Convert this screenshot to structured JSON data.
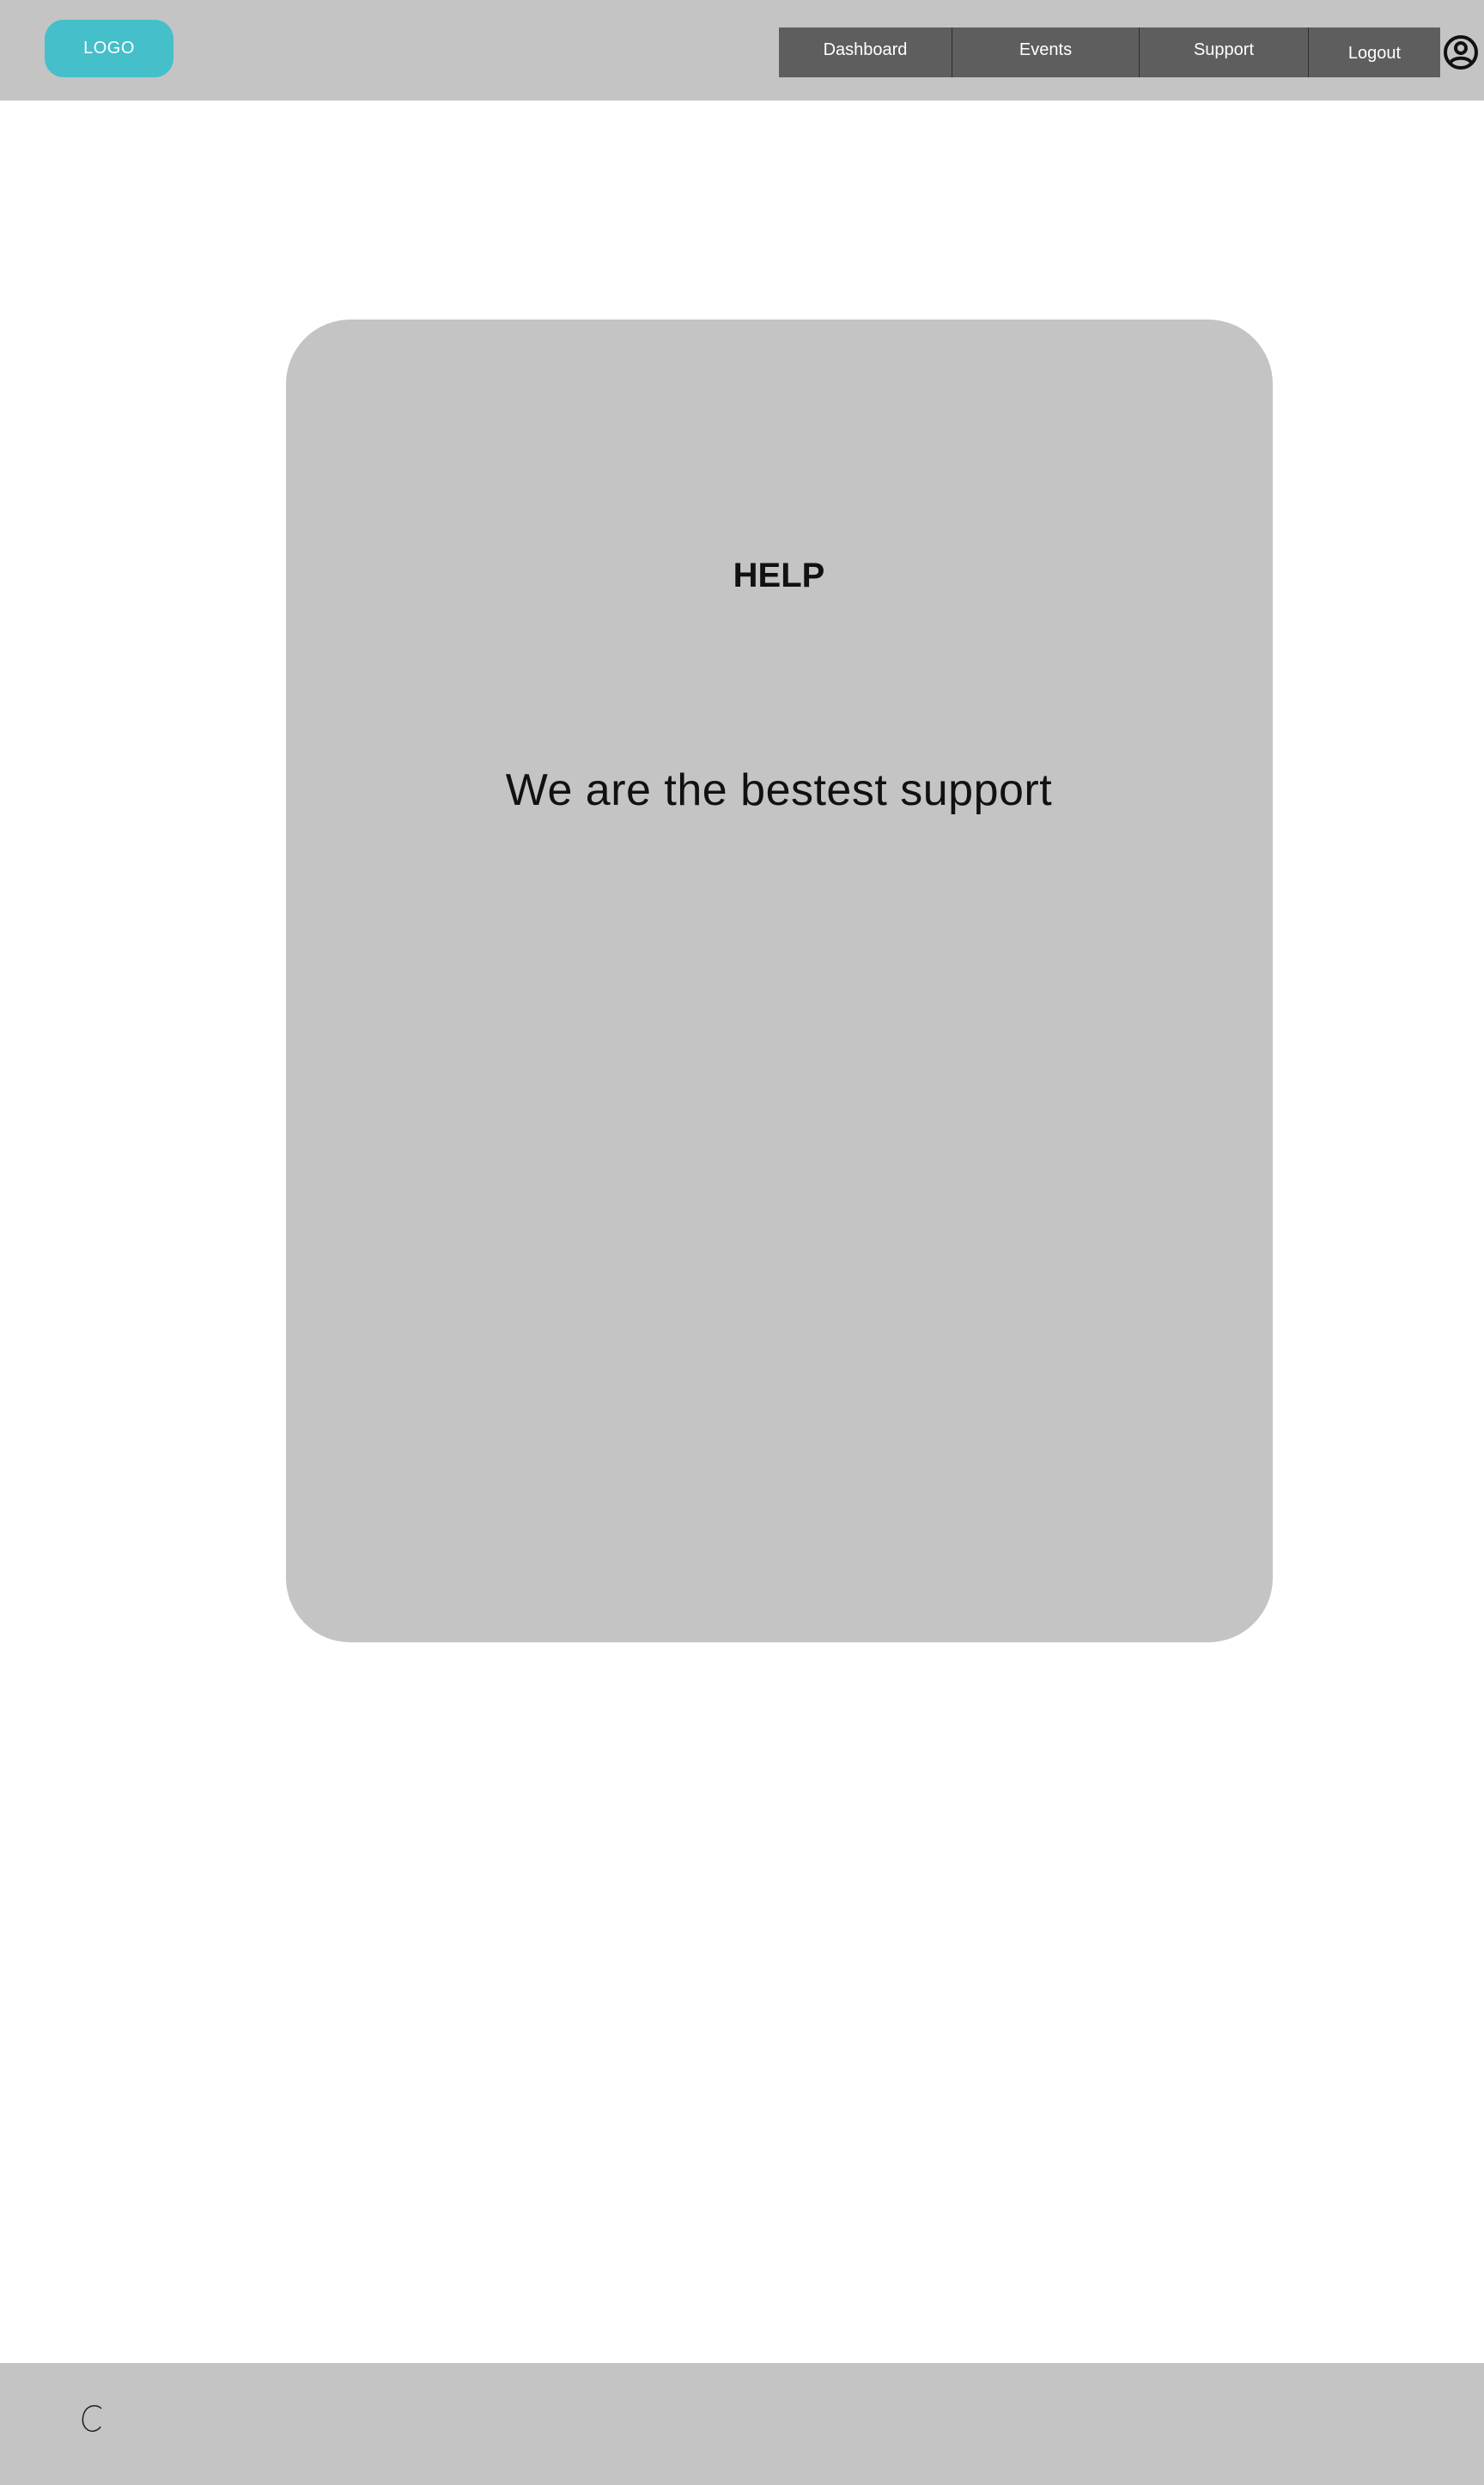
{
  "header": {
    "logo_label": "LOGO",
    "nav": {
      "dashboard": "Dashboard",
      "events": "Events",
      "support": "Support",
      "logout": "Logout"
    },
    "account_icon": "account-circle-icon"
  },
  "main": {
    "title": "HELP",
    "text": "We are the bestest support"
  },
  "footer": {
    "icon": "copyright-icon"
  },
  "colors": {
    "header_bg": "#c4c4c4",
    "logo_bg": "#45bfca",
    "nav_bg": "#5e5e5e",
    "card_bg": "#c4c4c4",
    "footer_bg": "#c4c4c4"
  }
}
